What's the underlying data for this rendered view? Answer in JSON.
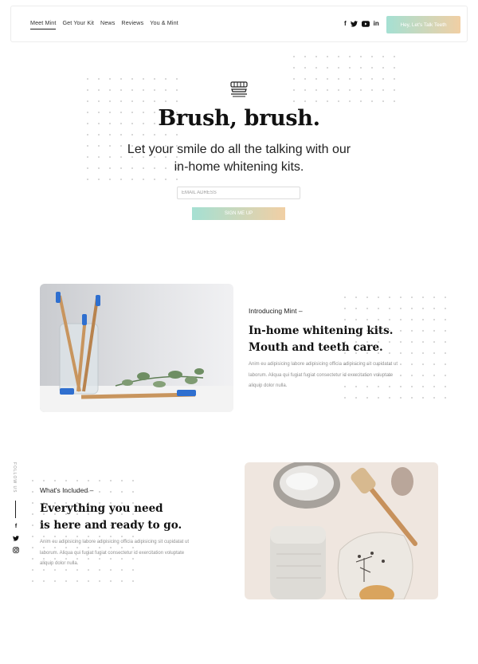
{
  "nav": {
    "items": [
      {
        "label": "Meet Mint",
        "active": true
      },
      {
        "label": "Get Your Kit",
        "active": false
      },
      {
        "label": "News",
        "active": false
      },
      {
        "label": "Reviews",
        "active": false
      },
      {
        "label": "You & Mint",
        "active": false
      }
    ],
    "social": [
      {
        "icon": "facebook-icon",
        "glyph": "f"
      },
      {
        "icon": "twitter-icon",
        "glyph": "🐦"
      },
      {
        "icon": "youtube-icon",
        "glyph": "▶"
      },
      {
        "icon": "linkedin-icon",
        "glyph": "in"
      }
    ],
    "cta_label": "Hey, Let's Talk Teeth"
  },
  "hero": {
    "logo_icon": "toothbrush-icon",
    "title": "Brush, brush.",
    "subtitle_line1": "Let your smile do all the talking with our",
    "subtitle_line2": "in-home whitening kits.",
    "email_placeholder": "EMAIL ADRESS",
    "signup_label": "SIGN ME UP"
  },
  "intro": {
    "eyebrow": "Introducing Mint –",
    "title_line1": "In-home whitening kits.",
    "title_line2": "Mouth and teeth care.",
    "body_line1": "Anim eu adipisicing labore adipisicing officia adipisicing sit cupidatat ut",
    "body_line2": "laborum. Aliqua qui fugiat fugiat consectetur id exercitation voluptate",
    "body_line3": "aliquip dolor nulla."
  },
  "included": {
    "eyebrow": "What's Included –",
    "title_line1": "Everything you need",
    "title_line2": "is here and ready to go.",
    "body_line1": "Anim eu adipisicing labore adipisicing officia adipisicing sit cupidatat ut",
    "body_line2": "laborum. Aliqua qui fugiat fugiat consectetur id exercitation voluptate",
    "body_line3": "aliquip dolor nulla."
  },
  "follow": {
    "label": "FOLLOW US",
    "icons": [
      "facebook-icon",
      "twitter-icon",
      "instagram-icon"
    ]
  },
  "colors": {
    "gradient_start": "#a5e0d3",
    "gradient_end": "#f1cfa4",
    "text_dark": "#111111"
  }
}
